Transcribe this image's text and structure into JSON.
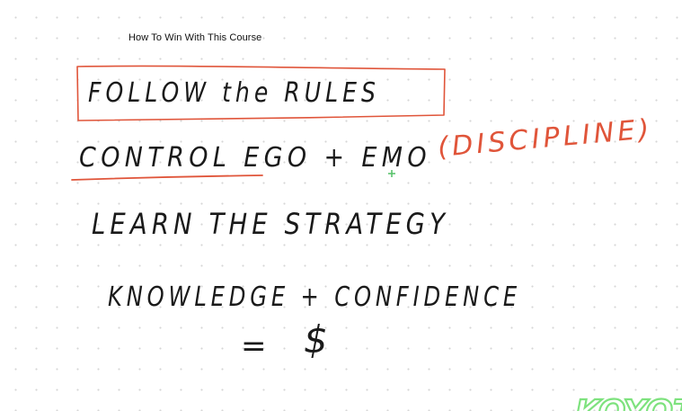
{
  "page": {
    "title": "How To Win With This Course"
  },
  "colors": {
    "ink": "#1a1a1a",
    "accent": "#e0553a",
    "cursor": "#5cc36e",
    "watermark": "#7ee27e"
  },
  "notes": {
    "line1": "FOLLOW the RULES",
    "line2_main": "CONTROL EGO + EMO",
    "line2_note": "(DISCIPLINE)",
    "line3": "LEARN THE STRATEGY",
    "line4": "KNOWLEDGE + CONFIDENCE",
    "line5_eq": "=",
    "line5_sym": "$"
  },
  "watermark": {
    "text": "KOYOTO"
  }
}
